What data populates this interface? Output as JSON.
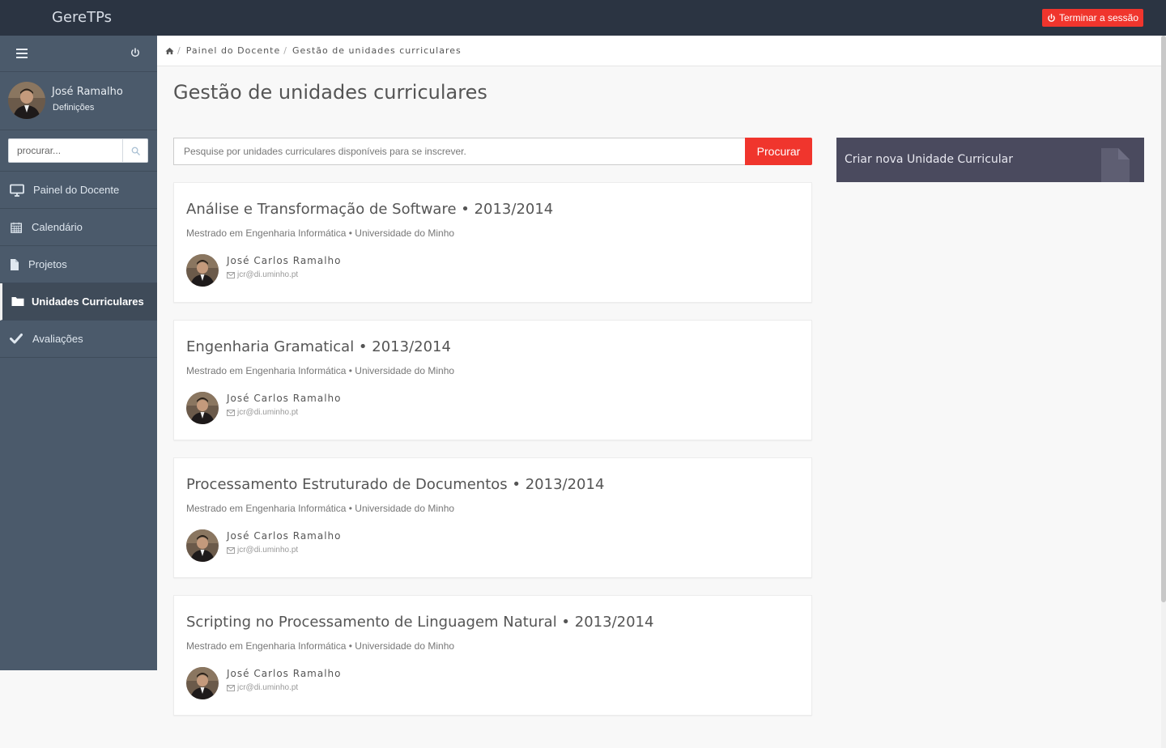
{
  "app": {
    "brand": "GereTPs",
    "logout_label": "Terminar a sessão"
  },
  "sidebar": {
    "user_name": "José Ramalho",
    "settings_label": "Definições",
    "search_placeholder": "procurar...",
    "items": [
      {
        "label": "Painel do Docente",
        "icon": "monitor-icon"
      },
      {
        "label": "Calendário",
        "icon": "calendar-icon"
      },
      {
        "label": "Projetos",
        "icon": "file-icon"
      },
      {
        "label": "Unidades Curriculares",
        "icon": "folder-icon",
        "active": true
      },
      {
        "label": "Avaliações",
        "icon": "check-icon"
      }
    ]
  },
  "breadcrumb": {
    "home_icon": "home-icon",
    "items": [
      "Painel do Docente",
      "Gestão de unidades curriculares"
    ]
  },
  "page": {
    "title": "Gestão de unidades curriculares"
  },
  "search": {
    "placeholder": "Pesquise por unidades curriculares disponíveis para se inscrever.",
    "button_label": "Procurar"
  },
  "courses": [
    {
      "title": "Análise e Transformação de Software • 2013/2014",
      "subtitle": "Mestrado em Engenharia Informática • Universidade do Minho",
      "author": "José Carlos Ramalho",
      "email": "jcr@di.uminho.pt"
    },
    {
      "title": "Engenharia Gramatical • 2013/2014",
      "subtitle": "Mestrado em Engenharia Informática • Universidade do Minho",
      "author": "José Carlos Ramalho",
      "email": "jcr@di.uminho.pt"
    },
    {
      "title": "Processamento Estruturado de Documentos • 2013/2014",
      "subtitle": "Mestrado em Engenharia Informática • Universidade do Minho",
      "author": "José Carlos Ramalho",
      "email": "jcr@di.uminho.pt"
    },
    {
      "title": "Scripting no Processamento de Linguagem Natural • 2013/2014",
      "subtitle": "Mestrado em Engenharia Informática • Universidade do Minho",
      "author": "José Carlos Ramalho",
      "email": "jcr@di.uminho.pt"
    }
  ],
  "create_panel": {
    "label": "Criar nova Unidade Curricular",
    "icon": "document-icon"
  },
  "colors": {
    "accent": "#f0352d",
    "topbar": "#2b3442",
    "sidebar": "#4b5a6b",
    "create_panel": "#4a4a5e"
  }
}
